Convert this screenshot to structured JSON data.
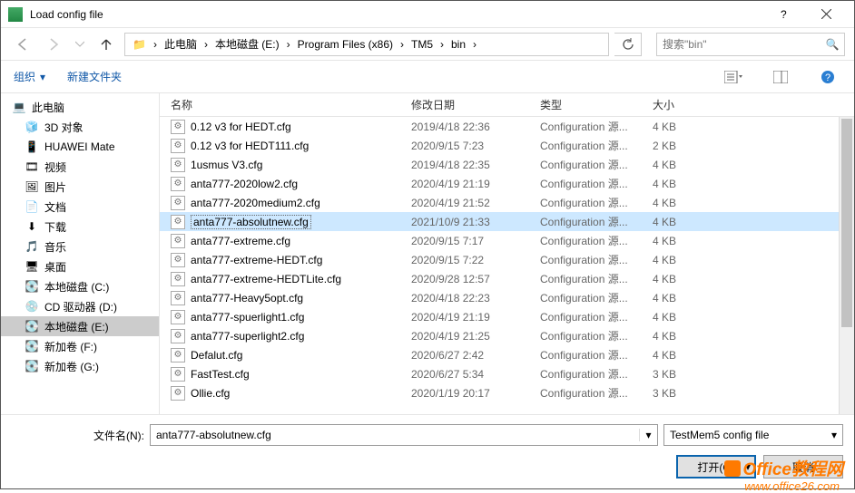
{
  "window": {
    "title": "Load config file"
  },
  "breadcrumb": [
    {
      "label": "此电脑"
    },
    {
      "label": "本地磁盘 (E:)"
    },
    {
      "label": "Program Files (x86)"
    },
    {
      "label": "TM5"
    },
    {
      "label": "bin"
    }
  ],
  "search": {
    "placeholder": "搜索\"bin\""
  },
  "toolbar": {
    "organize": "组织",
    "newfolder": "新建文件夹"
  },
  "columns": {
    "name": "名称",
    "date": "修改日期",
    "type": "类型",
    "size": "大小"
  },
  "sidebar": {
    "root": "此电脑",
    "items": [
      {
        "icon": "cube",
        "label": "3D 对象"
      },
      {
        "icon": "phone",
        "label": "HUAWEI Mate"
      },
      {
        "icon": "video",
        "label": "视频"
      },
      {
        "icon": "image",
        "label": "图片"
      },
      {
        "icon": "doc",
        "label": "文档"
      },
      {
        "icon": "download",
        "label": "下载"
      },
      {
        "icon": "music",
        "label": "音乐"
      },
      {
        "icon": "desktop",
        "label": "桌面"
      },
      {
        "icon": "disk",
        "label": "本地磁盘 (C:)"
      },
      {
        "icon": "cd",
        "label": "CD 驱动器 (D:)"
      },
      {
        "icon": "disk",
        "label": "本地磁盘 (E:)",
        "selected": true
      },
      {
        "icon": "disk",
        "label": "新加卷 (F:)"
      },
      {
        "icon": "disk",
        "label": "新加卷 (G:)"
      }
    ]
  },
  "files": [
    {
      "name": "0.12 v3 for HEDT.cfg",
      "date": "2019/4/18 22:36",
      "type": "Configuration 源...",
      "size": "4 KB"
    },
    {
      "name": "0.12 v3 for HEDT111.cfg",
      "date": "2020/9/15 7:23",
      "type": "Configuration 源...",
      "size": "2 KB"
    },
    {
      "name": "1usmus V3.cfg",
      "date": "2019/4/18 22:35",
      "type": "Configuration 源...",
      "size": "4 KB"
    },
    {
      "name": "anta777-2020low2.cfg",
      "date": "2020/4/19 21:19",
      "type": "Configuration 源...",
      "size": "4 KB"
    },
    {
      "name": "anta777-2020medium2.cfg",
      "date": "2020/4/19 21:52",
      "type": "Configuration 源...",
      "size": "4 KB"
    },
    {
      "name": "anta777-absolutnew.cfg",
      "date": "2021/10/9 21:33",
      "type": "Configuration 源...",
      "size": "4 KB",
      "selected": true
    },
    {
      "name": "anta777-extreme.cfg",
      "date": "2020/9/15 7:17",
      "type": "Configuration 源...",
      "size": "4 KB"
    },
    {
      "name": "anta777-extreme-HEDT.cfg",
      "date": "2020/9/15 7:22",
      "type": "Configuration 源...",
      "size": "4 KB"
    },
    {
      "name": "anta777-extreme-HEDTLite.cfg",
      "date": "2020/9/28 12:57",
      "type": "Configuration 源...",
      "size": "4 KB"
    },
    {
      "name": "anta777-Heavy5opt.cfg",
      "date": "2020/4/18 22:23",
      "type": "Configuration 源...",
      "size": "4 KB"
    },
    {
      "name": "anta777-spuerlight1.cfg",
      "date": "2020/4/19 21:19",
      "type": "Configuration 源...",
      "size": "4 KB"
    },
    {
      "name": "anta777-superlight2.cfg",
      "date": "2020/4/19 21:25",
      "type": "Configuration 源...",
      "size": "4 KB"
    },
    {
      "name": "Defalut.cfg",
      "date": "2020/6/27 2:42",
      "type": "Configuration 源...",
      "size": "4 KB"
    },
    {
      "name": "FastTest.cfg",
      "date": "2020/6/27 5:34",
      "type": "Configuration 源...",
      "size": "3 KB"
    },
    {
      "name": "Ollie.cfg",
      "date": "2020/1/19 20:17",
      "type": "Configuration 源...",
      "size": "3 KB"
    }
  ],
  "filename": {
    "label": "文件名(N):",
    "value": "anta777-absolutnew.cfg"
  },
  "filter": {
    "label": "TestMem5 config file"
  },
  "buttons": {
    "open": "打开(O)",
    "cancel": "取消"
  },
  "watermark": {
    "brand": "Office教程网",
    "url": "www.office26.com"
  }
}
